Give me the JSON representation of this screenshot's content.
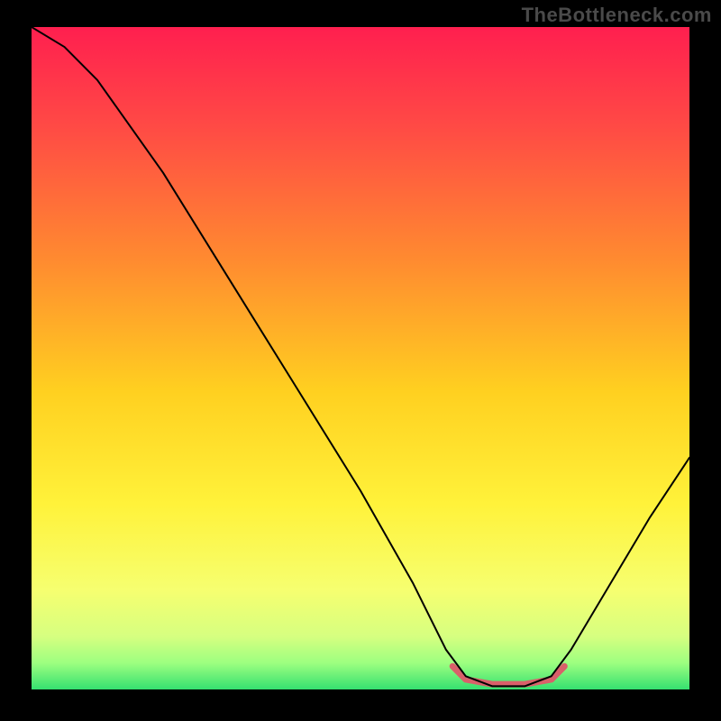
{
  "watermark": "TheBottleneck.com",
  "chart_data": {
    "type": "line",
    "title": "",
    "xlabel": "",
    "ylabel": "",
    "xlim": [
      0,
      100
    ],
    "ylim": [
      0,
      100
    ],
    "grid": false,
    "legend": false,
    "gradient_stops": [
      {
        "offset": 0.0,
        "color": "#ff1a4b"
      },
      {
        "offset": 0.5,
        "color": "#ffc points handled below"
      }
    ],
    "background_gradient": {
      "direction": "vertical",
      "stops": [
        {
          "pos": 0.0,
          "color": "#ff1f4f"
        },
        {
          "pos": 0.15,
          "color": "#ff4a45"
        },
        {
          "pos": 0.35,
          "color": "#ff8a30"
        },
        {
          "pos": 0.55,
          "color": "#ffd020"
        },
        {
          "pos": 0.72,
          "color": "#fff23a"
        },
        {
          "pos": 0.85,
          "color": "#f6ff70"
        },
        {
          "pos": 0.92,
          "color": "#d6ff80"
        },
        {
          "pos": 0.96,
          "color": "#9dff80"
        },
        {
          "pos": 1.0,
          "color": "#35e070"
        }
      ]
    },
    "series": [
      {
        "name": "bottleneck-curve",
        "color": "#000000",
        "width": 2,
        "points": [
          {
            "x": 0,
            "y": 100
          },
          {
            "x": 5,
            "y": 97
          },
          {
            "x": 10,
            "y": 92
          },
          {
            "x": 20,
            "y": 78
          },
          {
            "x": 30,
            "y": 62
          },
          {
            "x": 40,
            "y": 46
          },
          {
            "x": 50,
            "y": 30
          },
          {
            "x": 58,
            "y": 16
          },
          {
            "x": 63,
            "y": 6
          },
          {
            "x": 66,
            "y": 2
          },
          {
            "x": 70,
            "y": 0.5
          },
          {
            "x": 75,
            "y": 0.5
          },
          {
            "x": 79,
            "y": 2
          },
          {
            "x": 82,
            "y": 6
          },
          {
            "x": 88,
            "y": 16
          },
          {
            "x": 94,
            "y": 26
          },
          {
            "x": 100,
            "y": 35
          }
        ]
      },
      {
        "name": "optimal-range-marker",
        "color": "#d9606a",
        "width": 7,
        "points": [
          {
            "x": 64,
            "y": 3.5
          },
          {
            "x": 66,
            "y": 1.5
          },
          {
            "x": 70,
            "y": 0.8
          },
          {
            "x": 75,
            "y": 0.8
          },
          {
            "x": 79,
            "y": 1.5
          },
          {
            "x": 81,
            "y": 3.5
          }
        ]
      }
    ]
  }
}
